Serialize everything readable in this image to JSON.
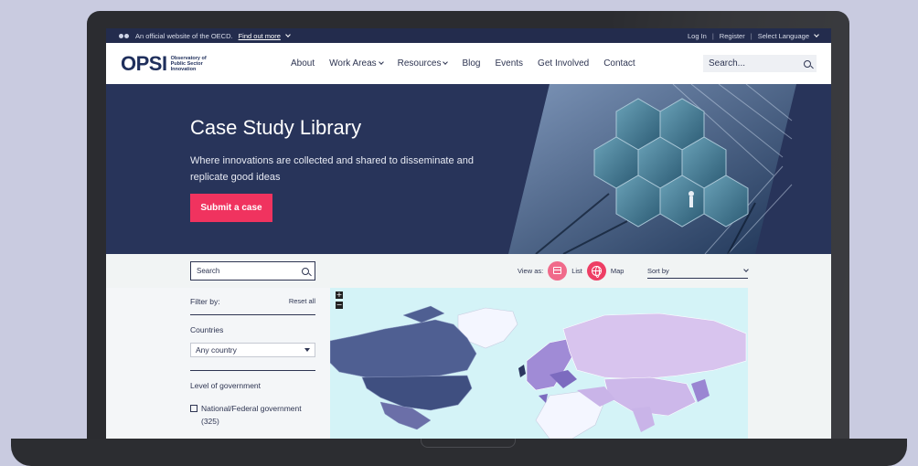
{
  "topbar": {
    "official_text": "An official website of the OECD.",
    "find_out_more": "Find out more",
    "log_in": "Log In",
    "register": "Register",
    "select_language": "Select Language",
    "separator": "|"
  },
  "header": {
    "logo_mark": "OPSI",
    "logo_lines": [
      "Observatory of",
      "Public Sector",
      "Innovation"
    ],
    "nav": [
      {
        "label": "About",
        "dropdown": false
      },
      {
        "label": "Work Areas",
        "dropdown": true
      },
      {
        "label": "Resources",
        "dropdown": true
      },
      {
        "label": "Blog",
        "dropdown": false
      },
      {
        "label": "Events",
        "dropdown": false
      },
      {
        "label": "Get Involved",
        "dropdown": false
      },
      {
        "label": "Contact",
        "dropdown": false
      }
    ],
    "search_placeholder": "Search..."
  },
  "hero": {
    "title": "Case Study Library",
    "subtitle": "Where innovations are collected and shared to disseminate and replicate good ideas",
    "cta": "Submit a case"
  },
  "filter_bar": {
    "search_placeholder": "Search",
    "view_as": "View as:",
    "list": "List",
    "map": "Map",
    "sort_by": "Sort by"
  },
  "sidebar": {
    "filter_by": "Filter by:",
    "reset_all": "Reset all",
    "countries_heading": "Countries",
    "country_value": "Any country",
    "level_heading": "Level of government",
    "options": [
      {
        "label": "National/Federal government (325)"
      }
    ]
  },
  "map": {
    "zoom_in": "+",
    "zoom_out": "−"
  },
  "colors": {
    "navy": "#28345a",
    "accent_pink": "#f0335f",
    "map_ocean": "#d4f3f7",
    "map_dark": "#4f5f92",
    "map_light_purple": "#d8c4ee"
  }
}
